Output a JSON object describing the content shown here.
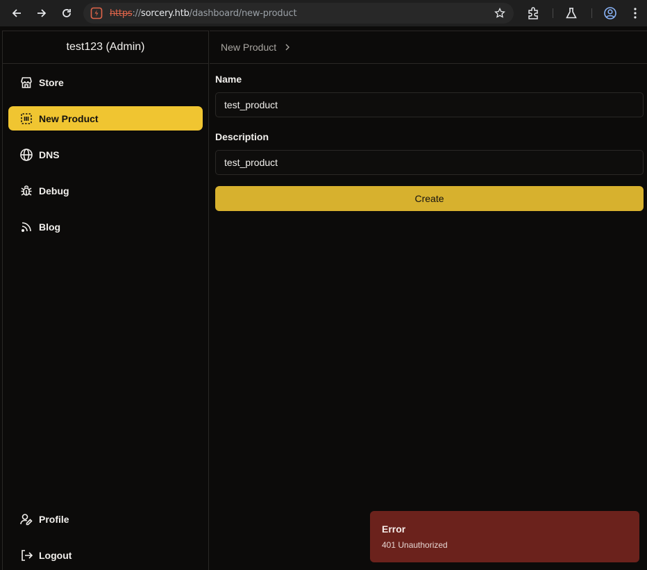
{
  "browser": {
    "url_scheme": "https",
    "url_separator": "://",
    "url_host": "sorcery.htb",
    "url_path": "/dashboard/new-product"
  },
  "sidebar": {
    "user_title": "test123 (Admin)",
    "items": [
      {
        "label": "Store",
        "icon": "store-icon"
      },
      {
        "label": "New Product",
        "icon": "new-product-icon",
        "active": true
      },
      {
        "label": "DNS",
        "icon": "globe-icon"
      },
      {
        "label": "Debug",
        "icon": "bug-icon"
      },
      {
        "label": "Blog",
        "icon": "rss-icon"
      }
    ],
    "bottom_items": [
      {
        "label": "Profile",
        "icon": "user-edit-icon"
      },
      {
        "label": "Logout",
        "icon": "logout-icon"
      }
    ]
  },
  "breadcrumb": {
    "current": "New Product"
  },
  "form": {
    "name_label": "Name",
    "name_value": "test_product",
    "description_label": "Description",
    "description_value": "test_product",
    "submit_label": "Create"
  },
  "toast": {
    "title": "Error",
    "message": "401 Unauthorized"
  },
  "colors": {
    "accent": "#f0c531",
    "button": "#d7b12e",
    "error": "#6b221c",
    "background": "#0c0b0a"
  }
}
